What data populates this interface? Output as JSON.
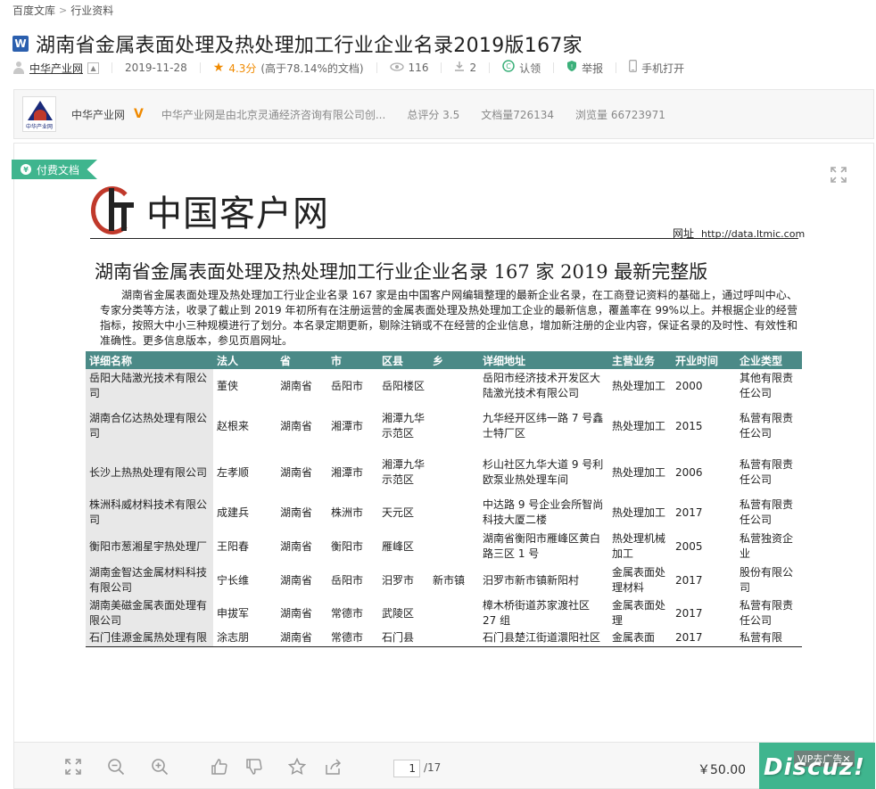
{
  "breadcrumb": {
    "root": "百度文库",
    "separator": ">",
    "current": "行业资料"
  },
  "title": {
    "icon": "W",
    "text": "湖南省金属表面处理及热处理加工行业企业名录2019版167家"
  },
  "meta": {
    "author": "中华产业网",
    "date": "2019-11-28",
    "rating": "4.3分",
    "rating_note": "(高于78.14%的文档)",
    "views": "116",
    "downloads": "2",
    "certify": "认领",
    "report": "举报",
    "mobile": "手机打开"
  },
  "publisher": {
    "logo_text": "中华产业网",
    "name": "中华产业网",
    "badge": "V",
    "description": "中华产业网是由北京灵通经济咨询有限公司创...",
    "score": "总评分 3.5",
    "doc_count": "文档量726134",
    "view_count": "浏览量 66723971"
  },
  "viewer": {
    "paid_tag": "付费文档",
    "coin_glyph": "¥",
    "doc_logo_name": "中国客户网",
    "doc_url_label": "网址",
    "doc_url": "http://data.ltmic.com",
    "doc_title": "湖南省金属表面处理及热处理加工行业企业名录 167 家 2019 最新完整版",
    "doc_intro": "湖南省金属表面处理及热处理加工行业企业名录 167 家是由中国客户网编辑整理的最新企业名录，在工商登记资料的基础上，通过呼叫中心、专家分类等方法，收录了截止到 2019 年初所有在注册运营的金属表面处理及热处理加工企业的最新信息，覆盖率在 99%以上。并根据企业的经营指标，按照大中小三种规模进行了划分。本名录定期更新，剔除注销或不在经营的企业信息，增加新注册的企业内容，保证名录的及时性、有效性和准确性。更多信息版本，参见页眉网址。",
    "table": {
      "headers": [
        "详细名称",
        "法人",
        "省",
        "市",
        "区县",
        "乡",
        "详细地址",
        "主营业务",
        "开业时间",
        "企业类型"
      ],
      "rows": [
        [
          "岳阳大陆激光技术有限公司",
          "董侠",
          "湖南省",
          "岳阳市",
          "岳阳楼区",
          "",
          "岳阳市经济技术开发区大陆激光技术有限公司",
          "热处理加工",
          "2000",
          "其他有限责任公司"
        ],
        [
          "湖南合亿达热处理有限公司",
          "赵根来",
          "湖南省",
          "湘潭市",
          "湘潭九华示范区",
          "",
          "九华经开区纬一路 7 号鑫士特厂区",
          "热处理加工",
          "2015",
          "私营有限责任公司"
        ],
        [
          "长沙上热热处理有限公司",
          "左孝顺",
          "湖南省",
          "湘潭市",
          "湘潭九华示范区",
          "",
          "杉山社区九华大道 9 号利欧泵业热处理车间",
          "热处理加工",
          "2006",
          "私营有限责任公司"
        ],
        [
          "株洲科威材料技术有限公司",
          "成建兵",
          "湖南省",
          "株洲市",
          "天元区",
          "",
          "中达路 9 号企业会所智尚科技大厦二楼",
          "热处理加工",
          "2017",
          "私营有限责任公司"
        ],
        [
          "衡阳市葱湘星宇热处理厂",
          "王阳春",
          "湖南省",
          "衡阳市",
          "雁峰区",
          "",
          "湖南省衡阳市雁峰区黄白路三区 1 号",
          "热处理机械加工",
          "2005",
          "私营独资企业"
        ],
        [
          "湖南金智达金属材料科技有限公司",
          "宁长维",
          "湖南省",
          "岳阳市",
          "汨罗市",
          "新市镇",
          "汨罗市新市镇新阳村",
          "金属表面处理材料",
          "2017",
          "股份有限公司"
        ],
        [
          "湖南美磁金属表面处理有限公司",
          "申拔军",
          "湖南省",
          "常德市",
          "武陵区",
          "",
          "樟木桥街道苏家渡社区 27 组",
          "金属表面处理",
          "2017",
          "私营有限责任公司"
        ],
        [
          "石门佳源金属热处理有限",
          "涂志朋",
          "湖南省",
          "常德市",
          "石门县",
          "",
          "石门县楚江街道澴阳社区",
          "金属表面",
          "2017",
          "私营有限"
        ]
      ]
    }
  },
  "toolbar": {
    "page_current": "1",
    "page_total": "/17",
    "price": "￥50.00",
    "vip_ad": "VIP去广告✕",
    "watermark": "Discuz!"
  }
}
